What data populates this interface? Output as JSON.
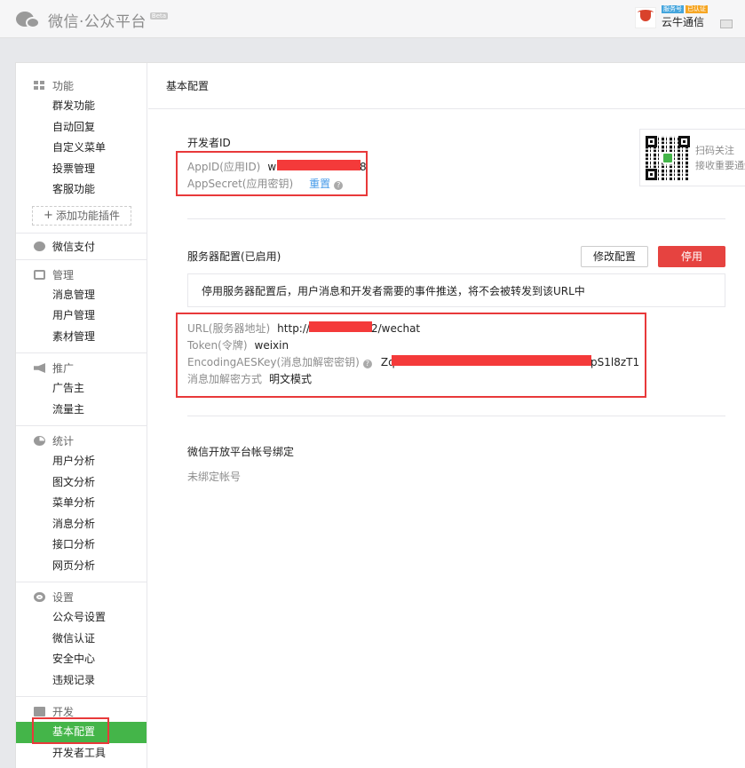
{
  "header": {
    "logo_text": "微信·公众平台",
    "beta": "Beta",
    "account": {
      "badge_type": "服务号",
      "badge_verified": "已认证",
      "name": "云牛通信"
    }
  },
  "sidebar": {
    "sections": [
      {
        "title": "功能",
        "icon": "grid-icon",
        "items": [
          "群发功能",
          "自动回复",
          "自定义菜单",
          "投票管理",
          "客服功能"
        ],
        "add_plugin": "添加功能插件"
      },
      {
        "title": "微信支付",
        "icon": "pay-icon",
        "items": []
      },
      {
        "title": "管理",
        "icon": "inbox-icon",
        "items": [
          "消息管理",
          "用户管理",
          "素材管理"
        ]
      },
      {
        "title": "推广",
        "icon": "megaphone-icon",
        "items": [
          "广告主",
          "流量主"
        ]
      },
      {
        "title": "统计",
        "icon": "pie-icon",
        "items": [
          "用户分析",
          "图文分析",
          "菜单分析",
          "消息分析",
          "接口分析",
          "网页分析"
        ]
      },
      {
        "title": "设置",
        "icon": "gear-icon",
        "items": [
          "公众号设置",
          "微信认证",
          "安全中心",
          "违规记录"
        ]
      },
      {
        "title": "开发",
        "icon": "code-icon",
        "items": [
          "基本配置",
          "开发者工具"
        ]
      }
    ]
  },
  "main": {
    "title": "基本配置",
    "developer": {
      "heading": "开发者ID",
      "appid_label": "AppID(应用ID)",
      "appid_prefix": "w",
      "appid_suffix": "8",
      "appsecret_label": "AppSecret(应用密钥)",
      "reset_link": "重置"
    },
    "qr": {
      "line1": "扫码关注",
      "line2": "接收重要通知"
    },
    "server": {
      "heading": "服务器配置(已启用)",
      "modify_button": "修改配置",
      "disable_button": "停用",
      "notice": "停用服务器配置后，用户消息和开发者需要的事件推送，将不会被转发到该URL中",
      "url_label": "URL(服务器地址)",
      "url_prefix": "http://",
      "url_suffix": "2/wechat",
      "token_label": "Token(令牌)",
      "token_value": "weixin",
      "aes_label": "EncodingAESKey(消息加解密密钥)",
      "aes_prefix": "Zq",
      "aes_suffix": "pS1l8zT1",
      "mode_label": "消息加解密方式",
      "mode_value": "明文模式"
    },
    "open_platform": {
      "heading": "微信开放平台帐号绑定",
      "status": "未绑定帐号"
    }
  },
  "colors": {
    "accent_green": "#44b549",
    "danger_red": "#e64340",
    "link_blue": "#459ae9"
  }
}
